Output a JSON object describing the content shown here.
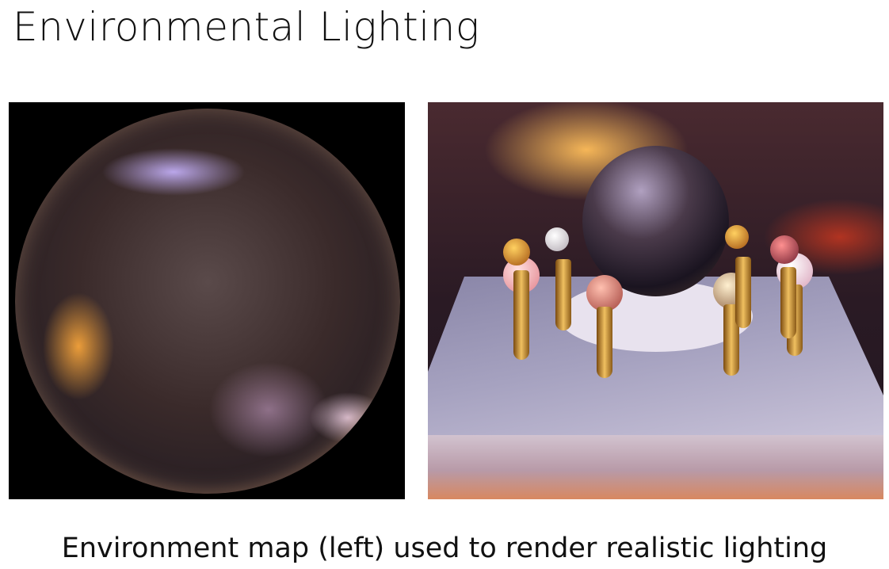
{
  "slide": {
    "title": "Environmental Lighting",
    "caption": "Environment map (left) used to render realistic lighting"
  },
  "images": {
    "left": "environment-map-sphere",
    "right": "rendered-scene-spheres-on-table"
  }
}
